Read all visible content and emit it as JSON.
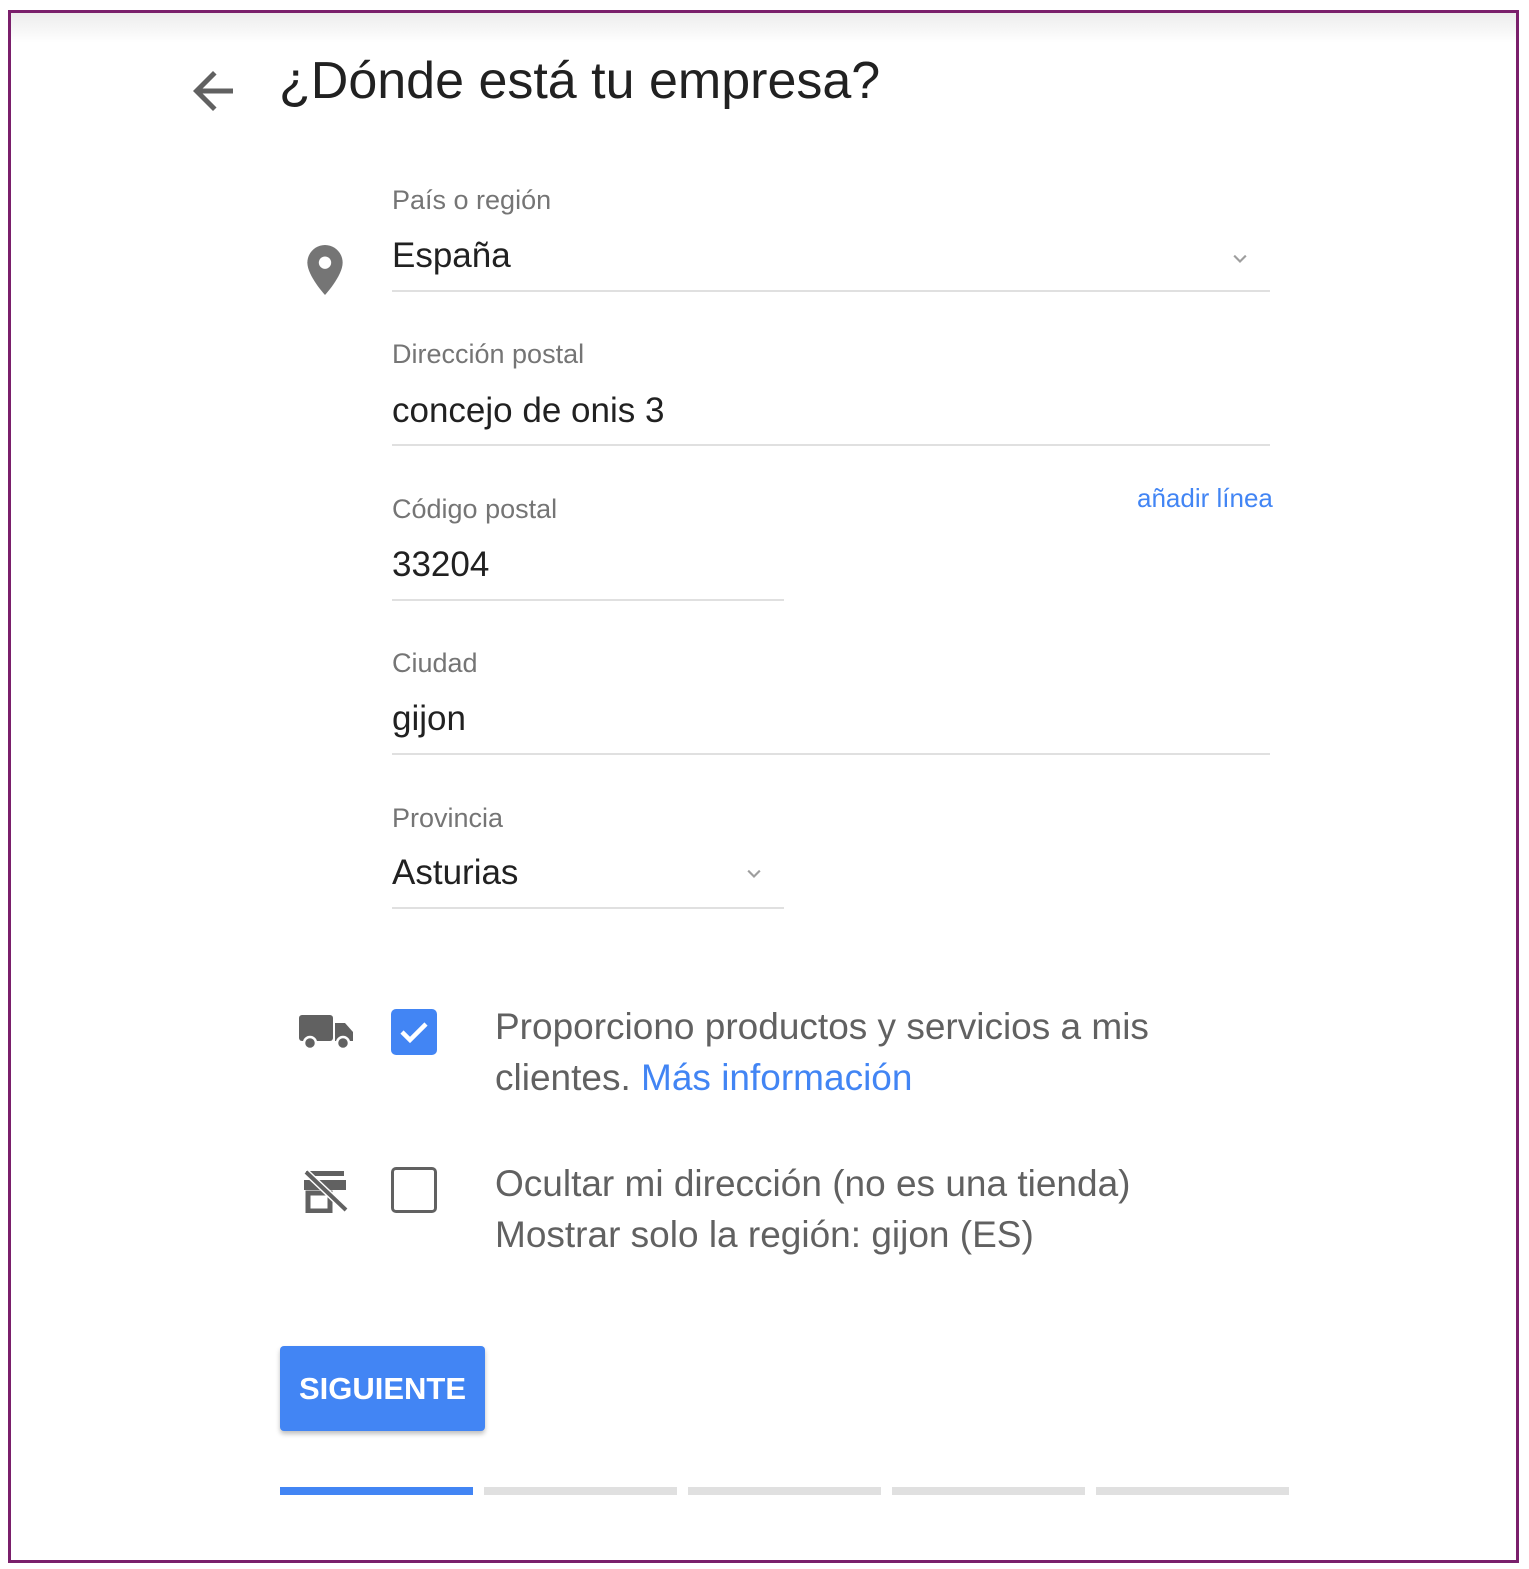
{
  "header": {
    "title": "¿Dónde está tu empresa?"
  },
  "icons": {
    "back": "arrow-left-icon",
    "location": "location-pin-icon",
    "delivery": "truck-icon",
    "hide_address": "store-off-icon",
    "dropdown": "chevron-down-icon"
  },
  "form": {
    "country": {
      "label": "País o región",
      "value": "España"
    },
    "address": {
      "label": "Dirección postal",
      "value": "concejo de onis 3"
    },
    "add_line": "añadir línea",
    "postal_code": {
      "label": "Código postal",
      "value": "33204"
    },
    "city": {
      "label": "Ciudad",
      "value": "gijon"
    },
    "province": {
      "label": "Provincia",
      "value": "Asturias"
    }
  },
  "options": {
    "delivery": {
      "checked": true,
      "text": "Proporciono productos y servicios a mis clientes.",
      "link": "Más información"
    },
    "hide_address": {
      "checked": false,
      "line1": "Ocultar mi dirección (no es una tienda)",
      "line2": "Mostrar solo la región: gijon (ES)"
    }
  },
  "actions": {
    "next": "SIGUIENTE"
  },
  "progress": {
    "current_step": 1,
    "total_steps": 5
  },
  "colors": {
    "accent": "#4285f4",
    "frame": "#7a1f6b",
    "text": "#212121",
    "muted": "#757575"
  }
}
